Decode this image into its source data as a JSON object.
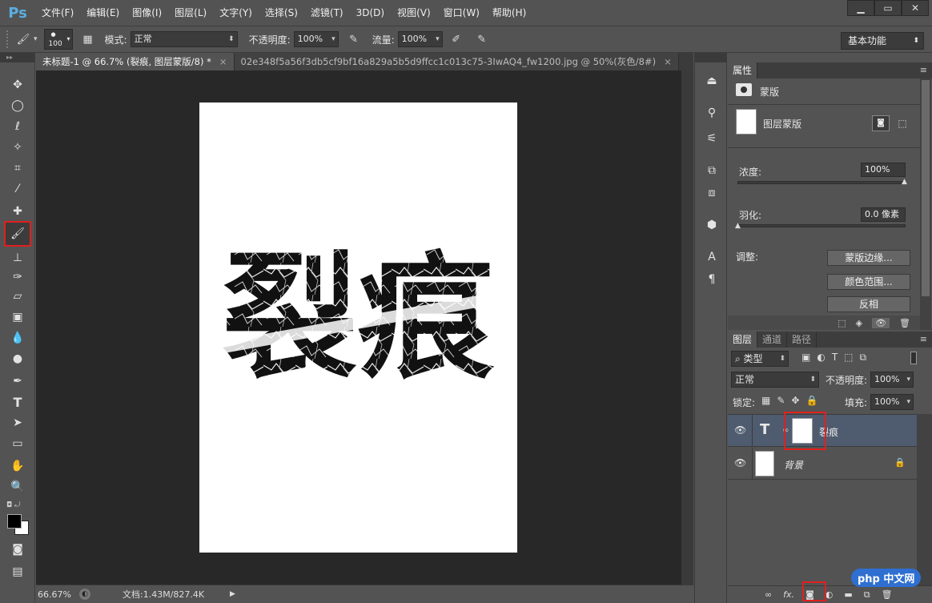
{
  "app": {
    "logo": "Ps",
    "menu": [
      "文件(F)",
      "编辑(E)",
      "图像(I)",
      "图层(L)",
      "文字(Y)",
      "选择(S)",
      "滤镜(T)",
      "3D(D)",
      "视图(V)",
      "窗口(W)",
      "帮助(H)"
    ],
    "window_controls": [
      "minimize-icon",
      "restore-icon",
      "close-icon"
    ]
  },
  "options": {
    "brush_size": "100",
    "mode_label": "模式:",
    "mode_value": "正常",
    "opacity_label": "不透明度:",
    "opacity_value": "100%",
    "flow_label": "流量:",
    "flow_value": "100%",
    "workspace": "基本功能"
  },
  "tabs": [
    {
      "label": "未标题-1 @ 66.7% (裂痕, 图层蒙版/8) *",
      "active": true
    },
    {
      "label": "02e348f5a56f3db5cf9bf16a829a5b5d9ffcc1c013c75-3IwAQ4_fw1200.jpg @ 50%(灰色/8#)",
      "active": false
    }
  ],
  "canvas": {
    "text": "裂痕",
    "text_color": "#111111"
  },
  "status": {
    "zoom": "66.67%",
    "doc_info": "文档:1.43M/827.4K"
  },
  "properties": {
    "tab": "属性",
    "section_title": "蒙版",
    "mask_label": "图层蒙版",
    "density_label": "浓度:",
    "density_value": "100%",
    "feather_label": "羽化:",
    "feather_value": "0.0 像素",
    "adjust_label": "调整:",
    "btn_edge": "蒙版边缘...",
    "btn_color_range": "颜色范围...",
    "btn_invert": "反相"
  },
  "layers": {
    "tabs": [
      "图层",
      "通道",
      "路径"
    ],
    "filter_kind": "类型",
    "blend_mode": "正常",
    "opacity_label": "不透明度:",
    "opacity_value": "100%",
    "lock_label": "锁定:",
    "fill_label": "填充:",
    "fill_value": "100%",
    "items": [
      {
        "name": "裂痕",
        "type": "text",
        "selected": true
      },
      {
        "name": "背景",
        "type": "background",
        "selected": false
      }
    ]
  },
  "watermark": "php 中文网",
  "colors": {
    "accent_red": "#e0201e",
    "selected_layer": "#4f5b6f",
    "panel_bg": "#535353",
    "canvas_bg": "#282828"
  }
}
